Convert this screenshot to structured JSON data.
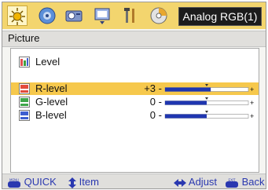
{
  "topbar": {
    "icons": [
      "picture-settings-icon",
      "image-adjust-icon",
      "projector-setup-icon",
      "display-option-icon",
      "tools-icon",
      "info-disc-icon"
    ],
    "source_label": "Analog RGB(1)"
  },
  "menu_title": "Picture",
  "items": [
    {
      "label": "Level",
      "icon": "level-icon"
    },
    {
      "label": "R-level",
      "value": "+3",
      "level": 3,
      "icon": "r-level-icon",
      "selected": true
    },
    {
      "label": "G-level",
      "value": "0",
      "level": 0,
      "icon": "g-level-icon"
    },
    {
      "label": "B-level",
      "value": "0",
      "level": 0,
      "icon": "b-level-icon"
    }
  ],
  "slider": {
    "min_symbol": "-",
    "max_symbol": "+"
  },
  "footer": {
    "quick": "QUICK",
    "item": "Item",
    "adjust": "Adjust",
    "back": "Back",
    "menu_key": "MENU",
    "exit_key": "EXIT"
  },
  "colors": {
    "topbar": "#f3d56e",
    "selected_row": "#f6c84c",
    "slider_fill": "#1f36b0",
    "footer_text": "#2a38b0"
  }
}
